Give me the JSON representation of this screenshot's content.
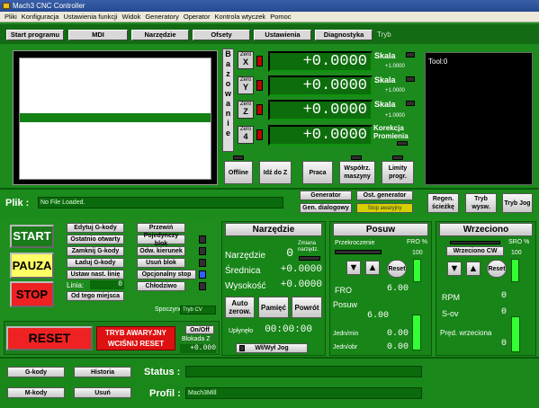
{
  "window": {
    "title": "Mach3 CNC Controller"
  },
  "menu": [
    "Pliki",
    "Konfiguracja",
    "Ustawienia funkcji",
    "Widok",
    "Generatory",
    "Operator",
    "Kontrola wtyczek",
    "Pomoc"
  ],
  "tabs": [
    "Start programu",
    "MDI",
    "Narzędzie",
    "Ofsety",
    "Ustawienia",
    "Diagnostyka"
  ],
  "tabs_mode": "Tryb",
  "axes": {
    "side_label": [
      "B",
      "a",
      "z",
      "o",
      "w",
      "a",
      "n",
      "i",
      "e"
    ],
    "rows": [
      {
        "zero": "Zero",
        "axis": "X",
        "value": "+0.0000",
        "scale_label": "Skala",
        "scale_val": "+1.0000"
      },
      {
        "zero": "Zero",
        "axis": "Y",
        "value": "+0.0000",
        "scale_label": "Skala",
        "scale_val": "+1.0000"
      },
      {
        "zero": "Zero",
        "axis": "Z",
        "value": "+0.0000",
        "scale_label": "Skala",
        "scale_val": "+1.0000"
      },
      {
        "zero": "Zero",
        "axis": "4",
        "value": "+0.0000",
        "scale_label": "Korekcja Promienia",
        "scale_val": ""
      }
    ]
  },
  "axis_buttons": [
    "Offline",
    "Idź do Z",
    "Praca",
    "Współrz. maszyny",
    "Limity progr."
  ],
  "toolpath": {
    "label": "Tool:0"
  },
  "file": {
    "label": "Plik :",
    "value": "No File Loaded."
  },
  "gen": {
    "generator": "Generator",
    "gen_dialog": "Gen. dialogowy",
    "ost_gen": "Ost. generator",
    "stop_awaryjny": "Stop awaryjny"
  },
  "regen": {
    "regen": "Regen. ścieżkę",
    "tryb_wysw": "Tryb wysw.",
    "tryb_jog": "Tryb Jog"
  },
  "control": {
    "start": "START",
    "pauza": "PAUZA",
    "stop": "STOP"
  },
  "gcode_buttons": [
    "Edytuj G-kody",
    "Ostatnio otwarty",
    "Zamknij G-kody",
    "Ładuj G-kody",
    "Ustaw nast. linię"
  ],
  "linia_label": "Linia:",
  "linia_value": "0",
  "od_tego": "Od tego miejsca",
  "toggles": [
    "Przewiń",
    "Pojedynczy blok",
    "Odw. kierunek",
    "Usuń blok",
    "Opcjonalny stop",
    "Chłodziwo"
  ],
  "spoczynek_label": "Spoczynek",
  "spoczynek_value": "Tryb CV",
  "reset": {
    "label": "RESET",
    "emergency": "TRYB AWARYJNY WCIŚNIJ RESET",
    "onoff": "On/Off",
    "blokada_label": "Blokada Z",
    "blokada_value": "+0.000"
  },
  "narzedzie": {
    "title": "Narzędzie",
    "narzedzie_label": "Narzędzie",
    "narzedzie_value": "0",
    "zmiana": "Zmiana narzędz.",
    "srednica_label": "Średnica",
    "srednica_value": "+0.0000",
    "wysokosc_label": "Wysokość",
    "wysokosc_value": "+0.0000",
    "auto_zero": "Auto zerow.",
    "pamiec": "Pamięć",
    "powrot": "Powrót",
    "uplynelo_label": "Upłynęło",
    "uplynelo_value": "00:00:00",
    "wl_jog": "Wł/Wył Jog"
  },
  "posuw": {
    "title": "Posuw",
    "przekroczenie": "Przekroczenie",
    "fro_pct": "FRO %",
    "fro_pct_val": "100",
    "reset": "Reset",
    "fro_label": "FRO",
    "fro_value": "6.00",
    "posuw_label": "Posuw",
    "posuw_value": "6.00",
    "jedn_min": "Jedn/min",
    "jedn_min_value": "0.00",
    "jedn_obr": "Jedn/obr",
    "jedn_obr_value": "0.00"
  },
  "wrzeciono": {
    "title": "Wrzeciono",
    "cw": "Wrzeciono CW",
    "sro_pct": "SRO %",
    "sro_pct_val": "100",
    "reset": "Reset",
    "rpm_label": "RPM",
    "rpm_value": "0",
    "sov_label": "S-ov",
    "sov_value": "0",
    "pred_label": "Pręd. wrzeciona",
    "pred_value": "0"
  },
  "bottom": {
    "gkody": "G-kody",
    "historia": "Historia",
    "mkody": "M-kody",
    "usun": "Usuń",
    "status_label": "Status :",
    "status_value": "",
    "profil_label": "Profil :",
    "profil_value": "Mach3Mill"
  }
}
